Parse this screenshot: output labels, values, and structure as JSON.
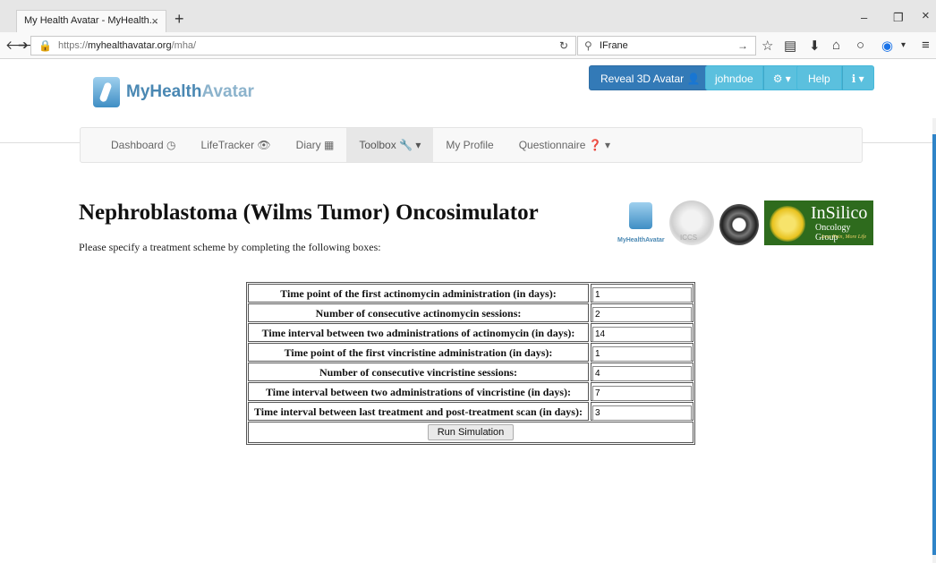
{
  "browser": {
    "tab_title": "My Health Avatar - MyHealth...",
    "tab_close": "×",
    "new_tab": "+",
    "url_prefix": "https://",
    "url_host": "myhealthavatar.org",
    "url_path": "/mha/",
    "search_value": "IFrane",
    "window_minimize": "–",
    "window_restore": "❐",
    "window_close": "×"
  },
  "site": {
    "logo_text_1": "MyHealth",
    "logo_text_2": "Avatar",
    "reveal_button": "Reveal 3D Avatar 👤",
    "user_button": "johndoe",
    "settings_button": "⚙ ▾",
    "help_button": "Help",
    "info_button": "ℹ ▾",
    "menu": [
      {
        "label": "Dashboard ◷"
      },
      {
        "label": "LifeTracker 👁"
      },
      {
        "label": "Diary ▦"
      },
      {
        "label": "Toolbox 🔧 ▾"
      },
      {
        "label": "My Profile"
      },
      {
        "label": "Questionnaire ❓ ▾"
      }
    ]
  },
  "page": {
    "title": "Nephroblastoma (Wilms Tumor) Oncosimulator",
    "subtitle": "Please specify a treatment scheme by completing the following boxes:",
    "partners": {
      "mha_label": "MyHealthAvatar",
      "iccs_label": "ICCS",
      "insilico_1": "InSilico",
      "insilico_2": "Oncology Group",
      "insilico_3": "Less Pain, More Life"
    },
    "form": [
      {
        "label": "Time point of the first actinomycin administration (in days):",
        "value": "1"
      },
      {
        "label": "Number of consecutive actinomycin sessions:",
        "value": "2"
      },
      {
        "label": "Time interval between two administrations of actinomycin (in days):",
        "value": "14"
      },
      {
        "label": "Time point of the first vincristine administration (in days):",
        "value": "1"
      },
      {
        "label": "Number of consecutive vincristine sessions:",
        "value": "4"
      },
      {
        "label": "Time interval between two administrations of vincristine (in days):",
        "value": "7"
      },
      {
        "label": "Time interval between last treatment and post-treatment scan (in days):",
        "value": "3"
      }
    ],
    "run_button": "Run Simulation"
  },
  "colors": {
    "primary": "#337ab7",
    "info": "#5bc0de",
    "navbar_bg": "#f8f8f8"
  }
}
